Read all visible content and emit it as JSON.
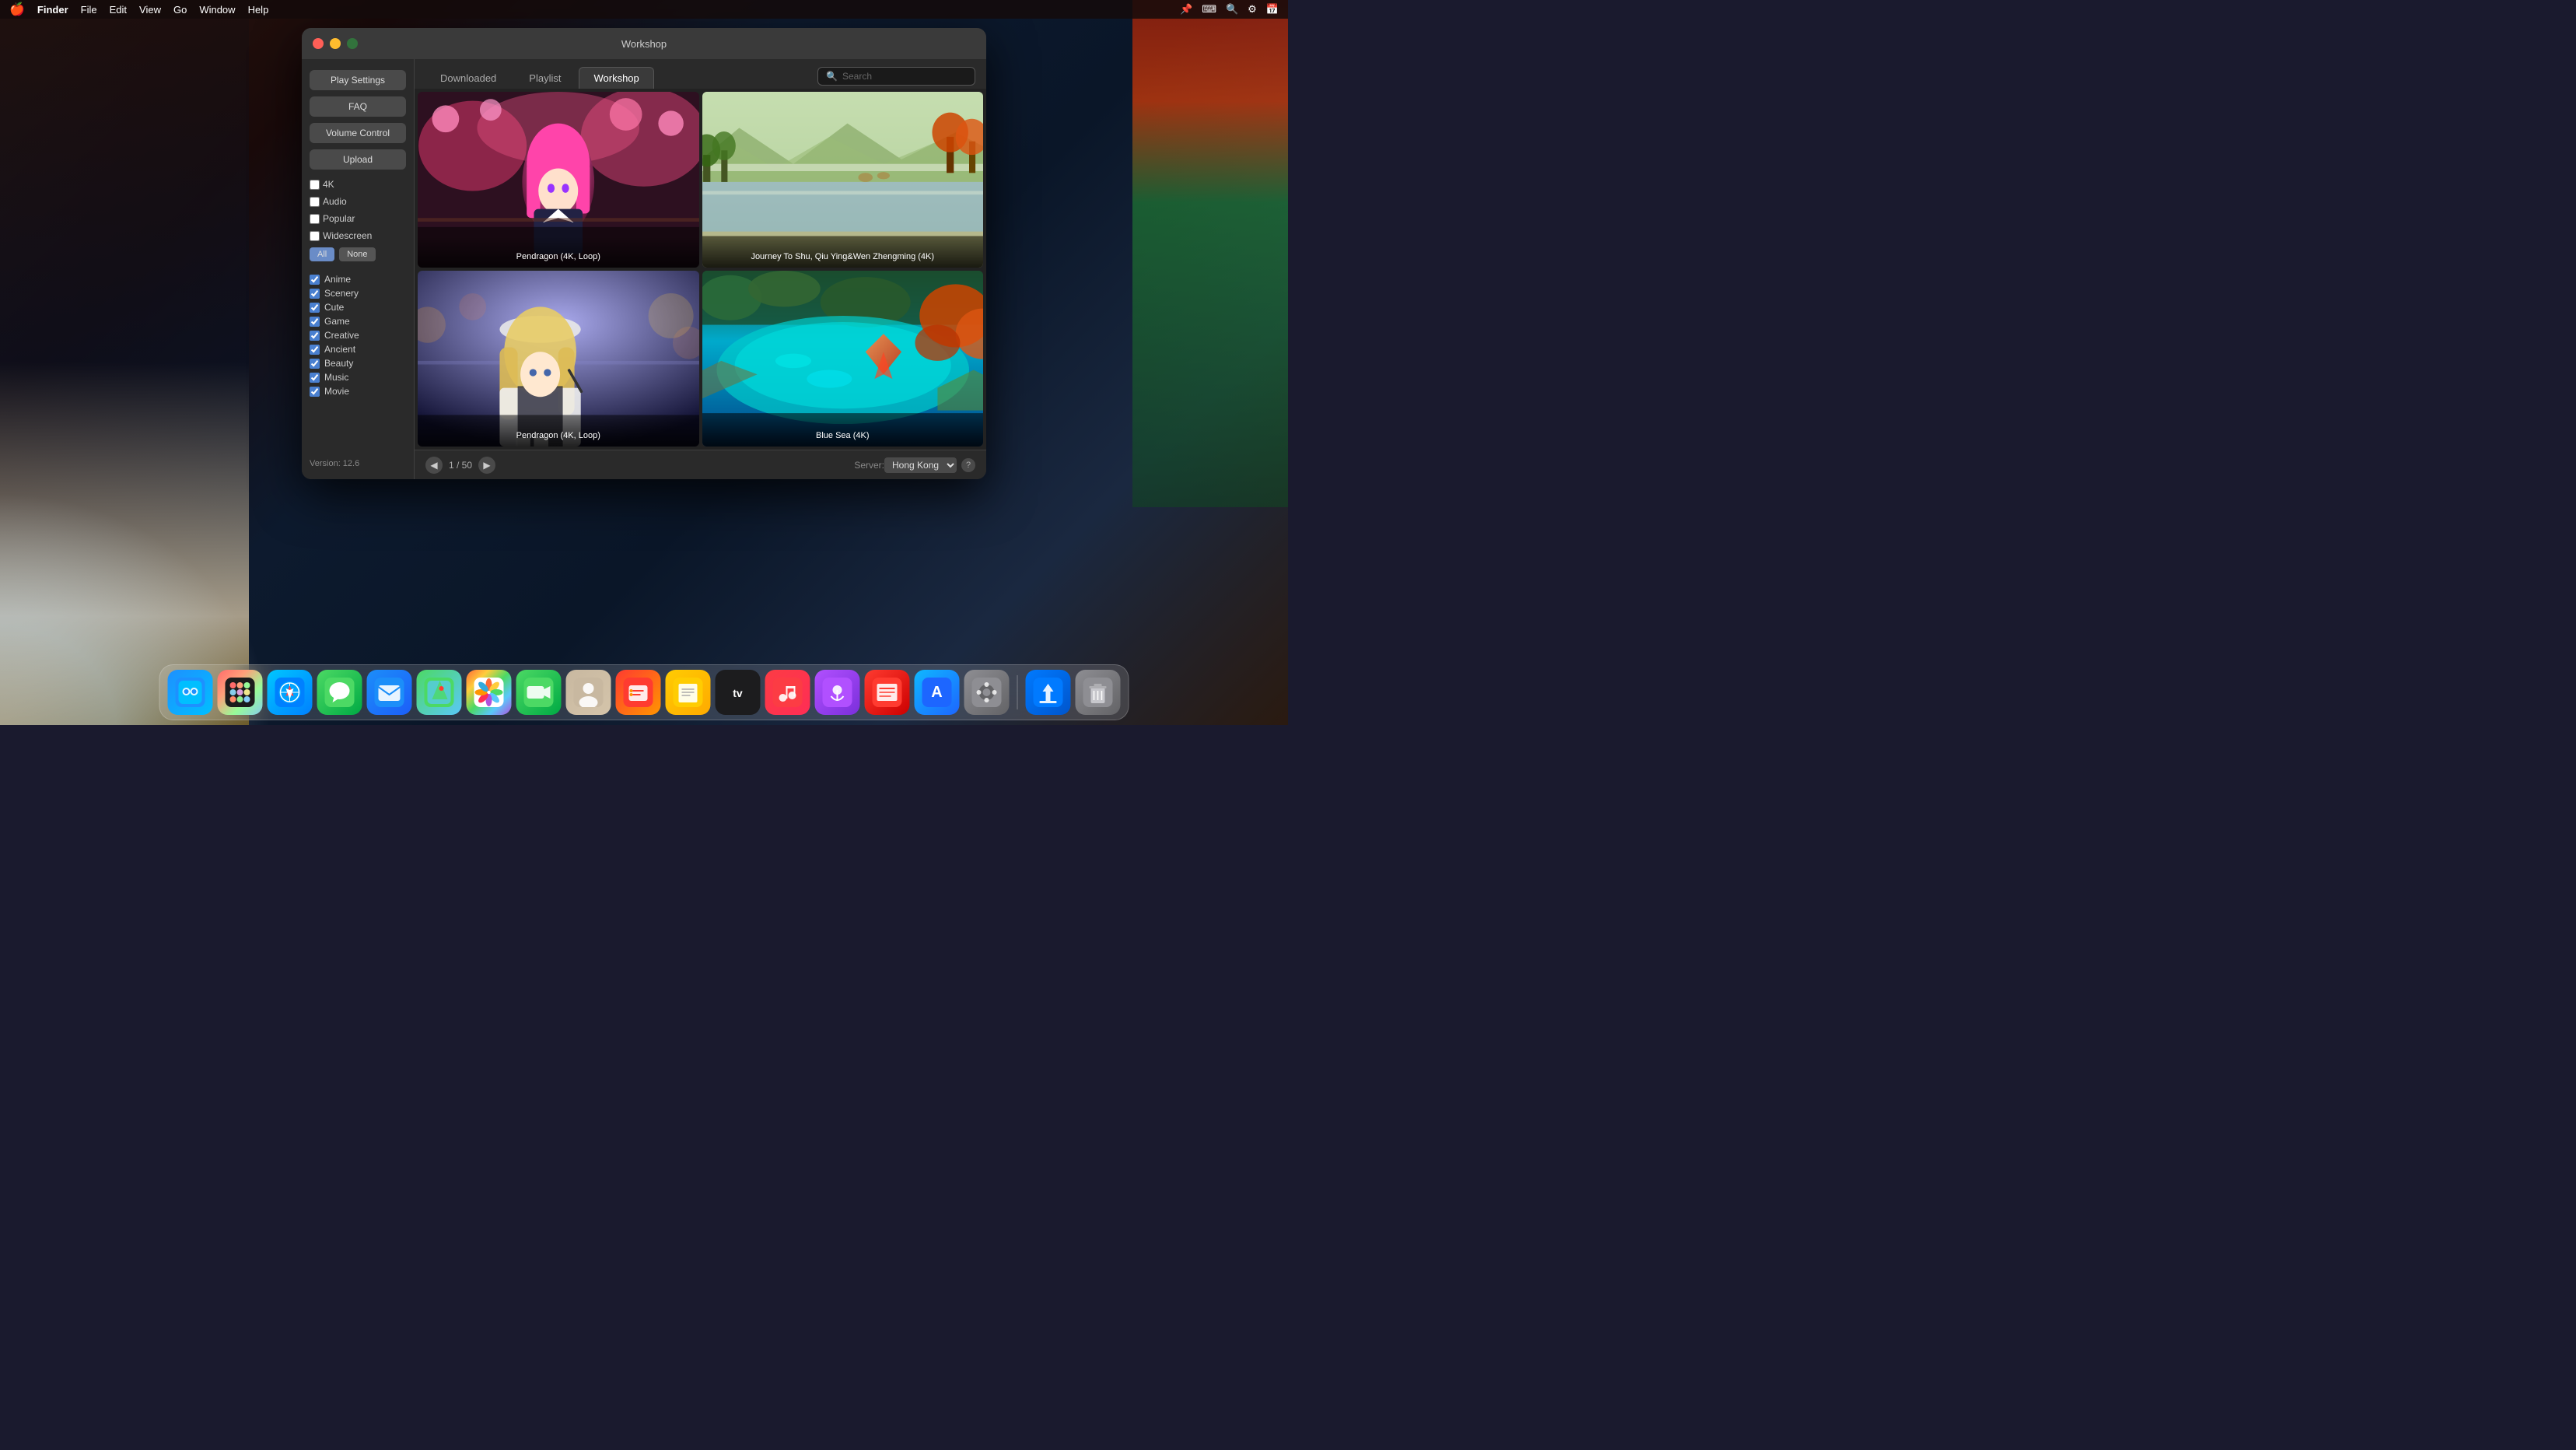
{
  "menubar": {
    "apple": "🍎",
    "app_name": "Finder",
    "items": [
      "File",
      "Edit",
      "View",
      "Go",
      "Window",
      "Help"
    ],
    "right_items": [
      "📌",
      "⌨",
      "🔍",
      "⚙",
      "📅"
    ]
  },
  "window": {
    "title": "Workshop",
    "tabs": [
      {
        "label": "Downloaded",
        "active": false
      },
      {
        "label": "Playlist",
        "active": false
      },
      {
        "label": "Workshop",
        "active": true
      }
    ],
    "search_placeholder": "Search"
  },
  "sidebar": {
    "buttons": [
      "Play Settings",
      "FAQ",
      "Volume Control",
      "Upload"
    ],
    "checkboxes_all": "All",
    "checkboxes_none": "None",
    "categories": [
      {
        "label": "Anime",
        "checked": true
      },
      {
        "label": "Scenery",
        "checked": true
      },
      {
        "label": "Cute",
        "checked": true
      },
      {
        "label": "Game",
        "checked": true
      },
      {
        "label": "Creative",
        "checked": true
      },
      {
        "label": "Ancient",
        "checked": true
      },
      {
        "label": "Beauty",
        "checked": true
      },
      {
        "label": "Music",
        "checked": true
      },
      {
        "label": "Movie",
        "checked": true
      }
    ],
    "version": "Version: 12.6"
  },
  "wallpapers": [
    {
      "title": "Pendragon (4K, Loop)",
      "row": 0,
      "col": 0,
      "type": "anime_pink"
    },
    {
      "title": "Journey To Shu, Qiu Ying&Wen Zhengming (4K)",
      "row": 0,
      "col": 1,
      "type": "chinese_painting"
    },
    {
      "title": "Pendragon (4K, Loop)",
      "row": 1,
      "col": 0,
      "type": "anime_blonde"
    },
    {
      "title": "Blue Sea (4K)",
      "row": 1,
      "col": 1,
      "type": "blue_sea"
    }
  ],
  "pagination": {
    "current": "1",
    "total": "50",
    "display": "1 / 50",
    "prev": "◀",
    "next": "▶"
  },
  "server": {
    "label": "Server:",
    "value": "Hong Kong"
  },
  "dock": {
    "apps": [
      {
        "name": "Finder",
        "icon": "🔵",
        "class": "dock-finder"
      },
      {
        "name": "Launchpad",
        "icon": "🚀",
        "class": "dock-launchpad"
      },
      {
        "name": "Safari",
        "icon": "🧭",
        "class": "dock-safari"
      },
      {
        "name": "Messages",
        "icon": "💬",
        "class": "dock-messages"
      },
      {
        "name": "Mail",
        "icon": "✉️",
        "class": "dock-mail"
      },
      {
        "name": "Maps",
        "icon": "🗺",
        "class": "dock-maps"
      },
      {
        "name": "Photos",
        "icon": "🌅",
        "class": "dock-photos"
      },
      {
        "name": "FaceTime",
        "icon": "📹",
        "class": "dock-facetime"
      },
      {
        "name": "Contacts",
        "icon": "👤",
        "class": "dock-contacts"
      },
      {
        "name": "Reminders",
        "icon": "📋",
        "class": "dock-reminders"
      },
      {
        "name": "Notes",
        "icon": "📝",
        "class": "dock-notes"
      },
      {
        "name": "Apple TV",
        "icon": "📺",
        "class": "dock-tv"
      },
      {
        "name": "Music",
        "icon": "🎵",
        "class": "dock-music"
      },
      {
        "name": "Podcasts",
        "icon": "🎙",
        "class": "dock-podcasts"
      },
      {
        "name": "News",
        "icon": "📰",
        "class": "dock-news"
      },
      {
        "name": "App Store",
        "icon": "🅰",
        "class": "dock-appstore"
      },
      {
        "name": "System Preferences",
        "icon": "⚙️",
        "class": "dock-syspref"
      },
      {
        "name": "Downloads",
        "icon": "⬇️",
        "class": "dock-downloads"
      },
      {
        "name": "Trash",
        "icon": "🗑",
        "class": "dock-trash"
      }
    ]
  }
}
